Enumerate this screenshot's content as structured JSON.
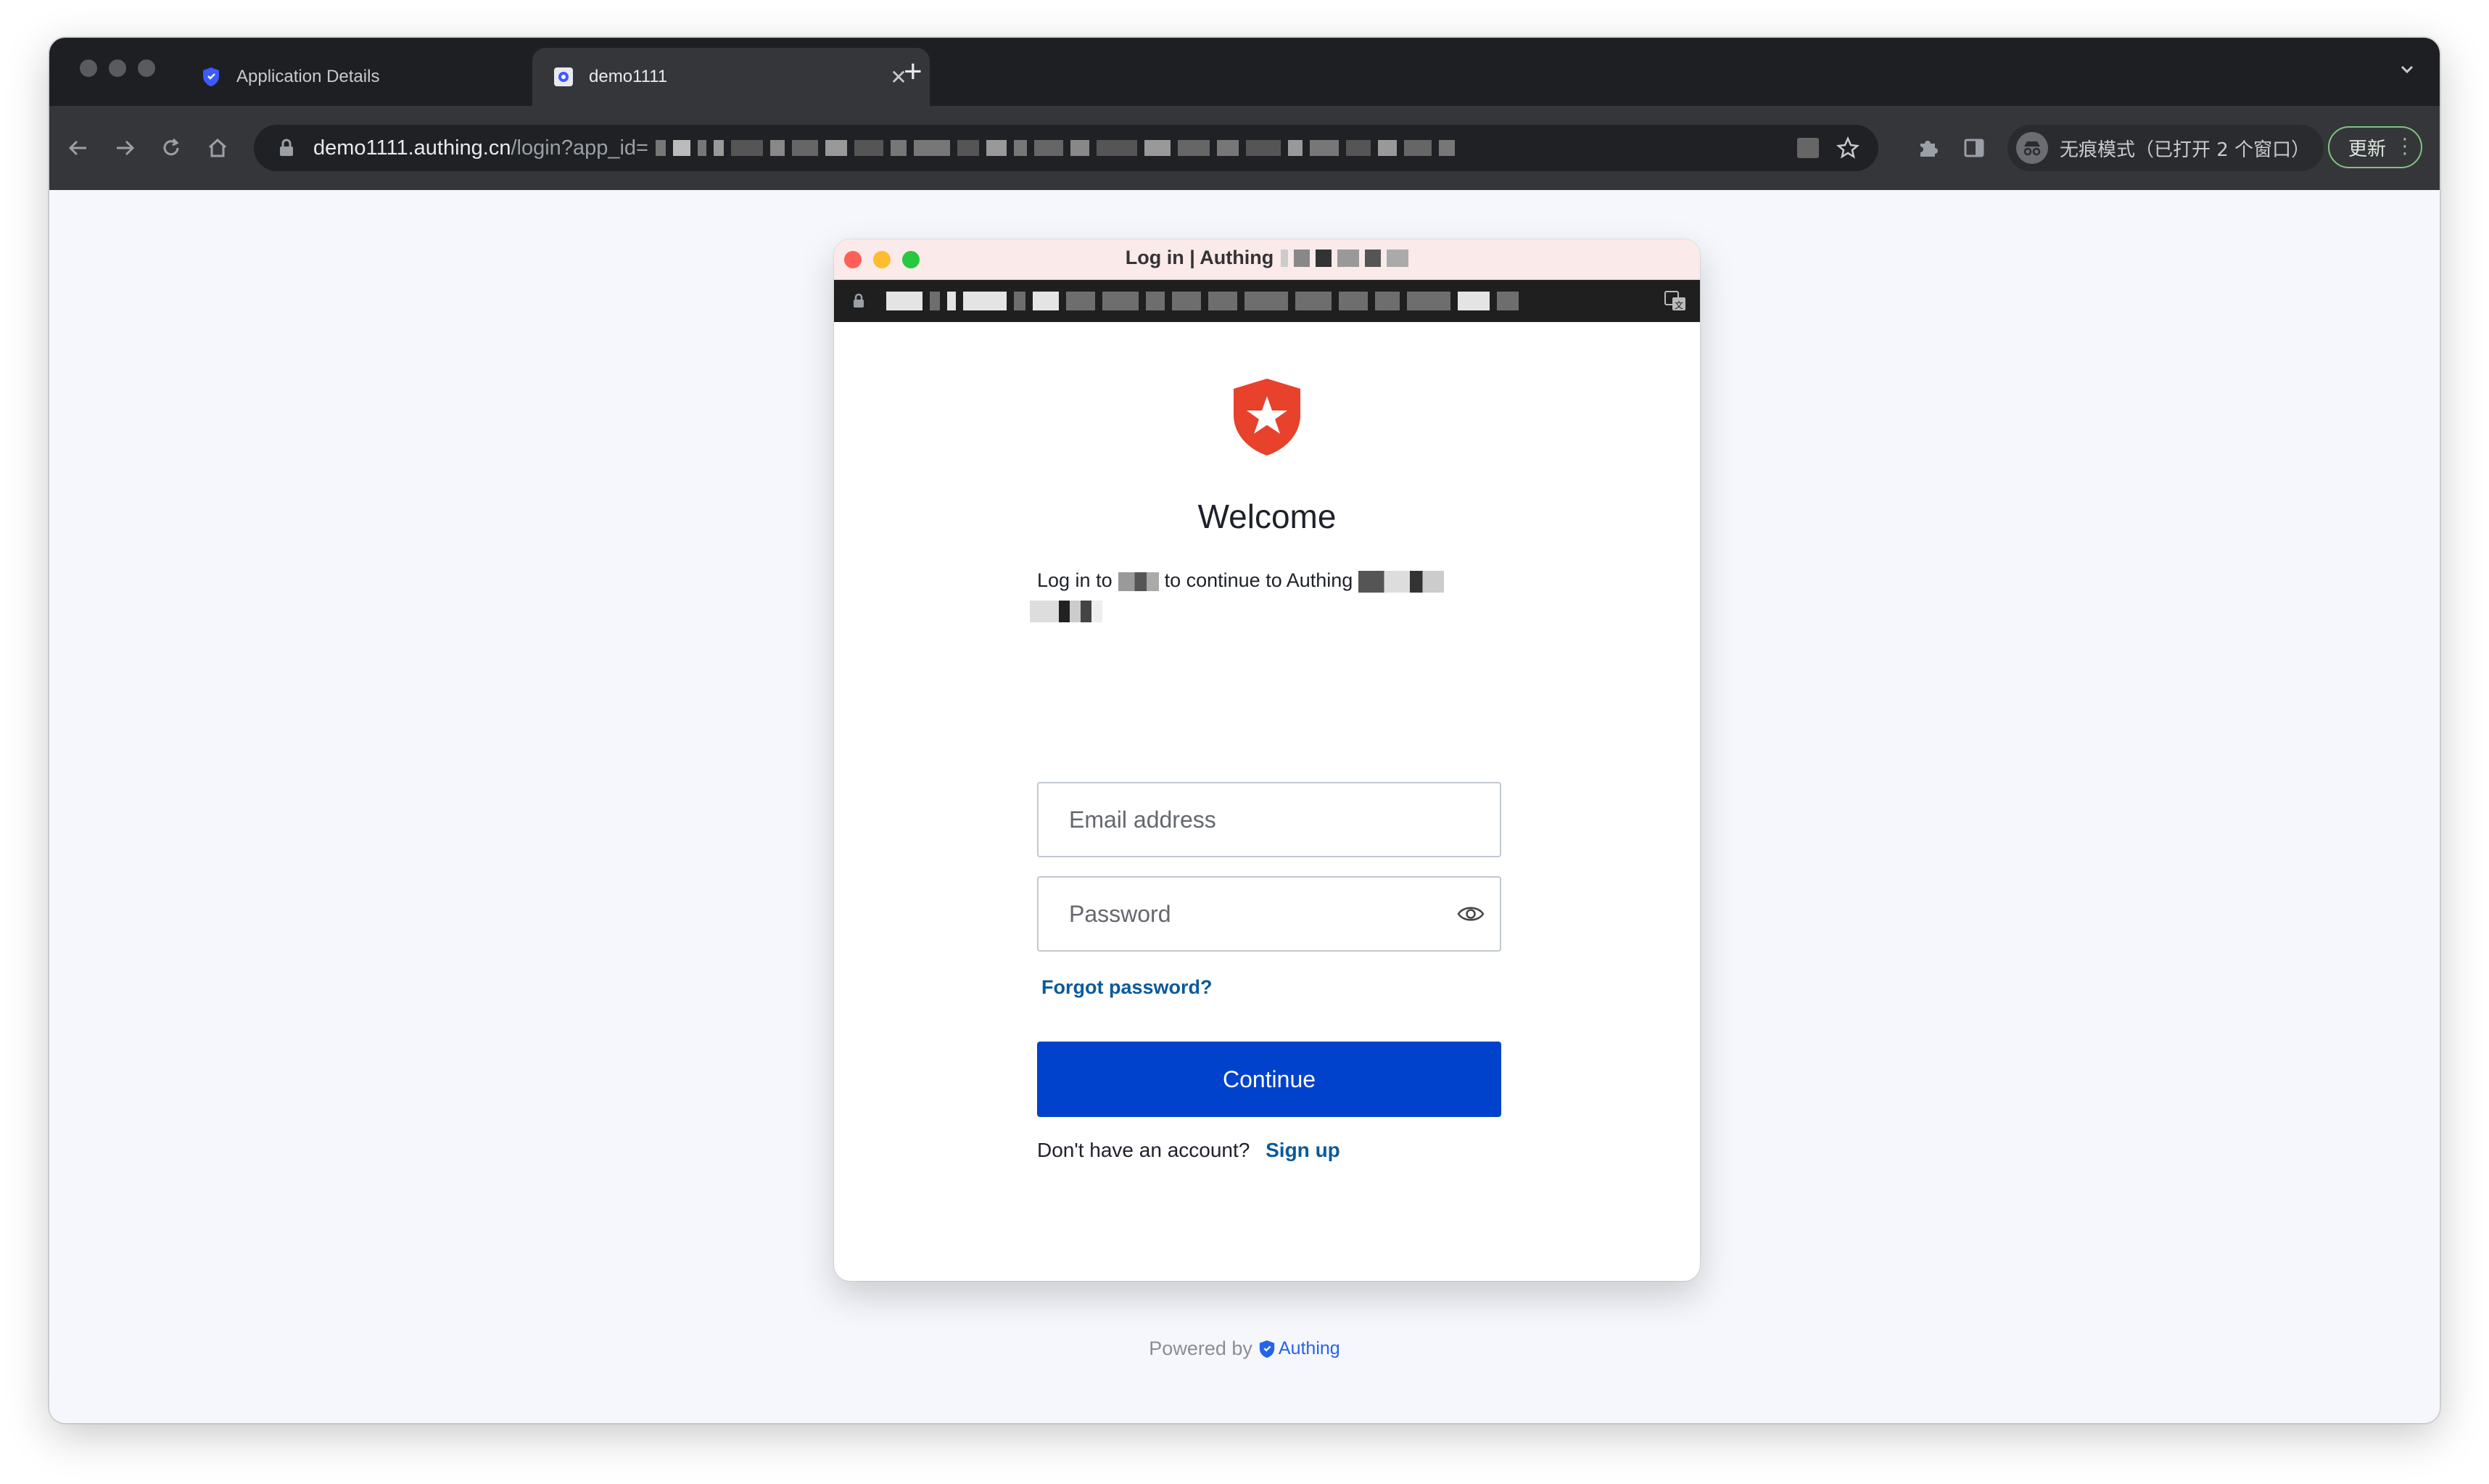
{
  "browser": {
    "tabs": [
      {
        "title": "Application Details",
        "active": false
      },
      {
        "title": "demo1111",
        "active": true
      }
    ],
    "address": {
      "host": "demo1111.authing.cn",
      "path": "/login?app_id="
    },
    "incognito_label": "无痕模式（已打开 2 个窗口）",
    "update_label": "更新"
  },
  "popup": {
    "window_title": "Log in | Authing",
    "welcome": "Welcome",
    "subtitle_prefix": "Log in to",
    "subtitle_middle": "to continue to Authing",
    "email": {
      "placeholder": "Email address",
      "value": ""
    },
    "password": {
      "placeholder": "Password",
      "value": ""
    },
    "forgot_password": "Forgot password?",
    "continue_label": "Continue",
    "signup_prompt": "Don't have an account?",
    "signup_link": "Sign up"
  },
  "footer": {
    "powered_by": "Powered by",
    "brand": "Authing"
  },
  "colors": {
    "primary_button": "#0042cc",
    "link": "#0a5a9a",
    "logo": "#e8412c"
  },
  "icons": [
    "shield-icon",
    "back-icon",
    "forward-icon",
    "reload-icon",
    "home-icon",
    "lock-icon",
    "star-icon",
    "puzzle-icon",
    "side-panel-icon",
    "incognito-icon",
    "eye-icon",
    "translate-icon",
    "star-shield-logo"
  ]
}
